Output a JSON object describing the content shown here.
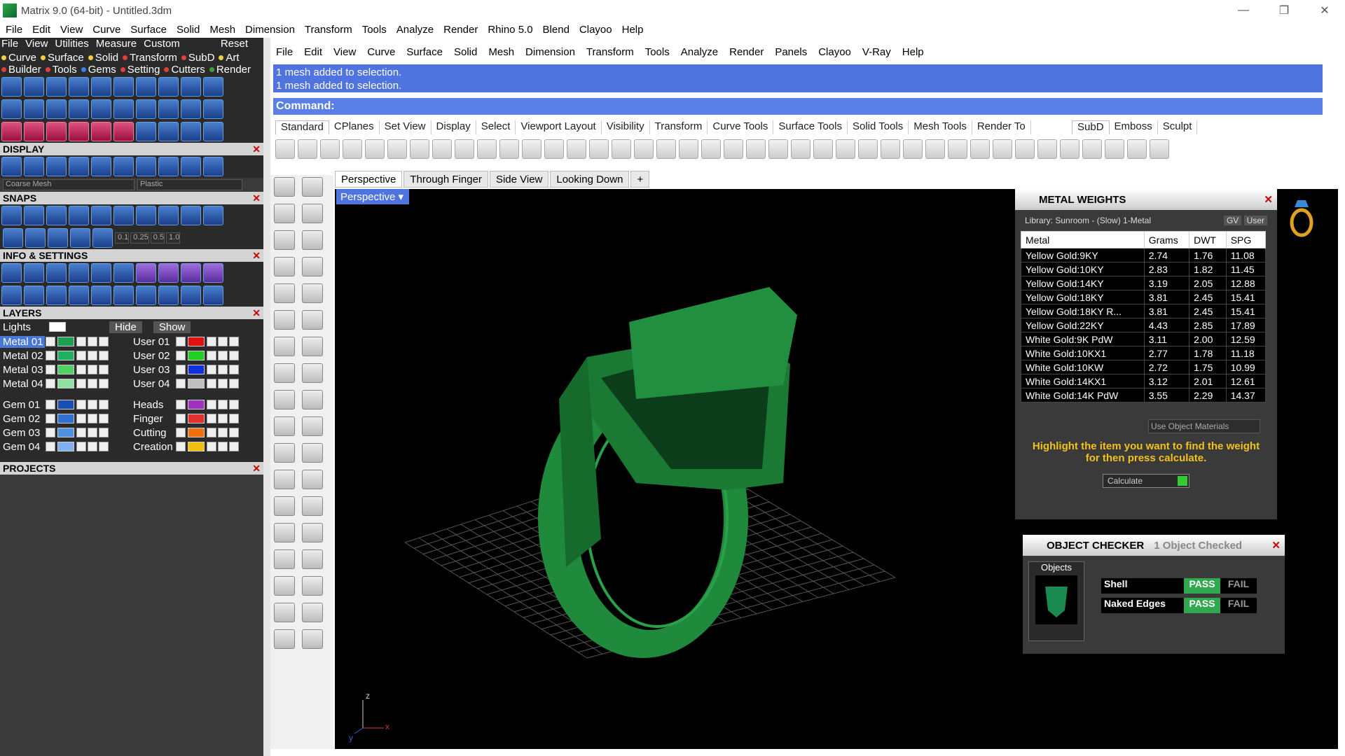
{
  "window": {
    "title": "Matrix 9.0 (64-bit) - Untitled.3dm"
  },
  "main_menu": [
    "File",
    "Edit",
    "View",
    "Curve",
    "Surface",
    "Solid",
    "Mesh",
    "Dimension",
    "Transform",
    "Tools",
    "Analyze",
    "Render",
    "Rhino 5.0",
    "Blend",
    "Clayoo",
    "Help"
  ],
  "left_menu": [
    "File",
    "View",
    "Utilities",
    "Measure",
    "Custom"
  ],
  "left_reset": "Reset",
  "tag_row1": [
    {
      "label": "Curve",
      "color": "#f0d040"
    },
    {
      "label": "Surface",
      "color": "#f0d040"
    },
    {
      "label": "Solid",
      "color": "#f0d040"
    },
    {
      "label": "Transform",
      "color": "#e04040"
    },
    {
      "label": "SubD",
      "color": "#e04040"
    },
    {
      "label": "Art",
      "color": "#f0d040"
    }
  ],
  "tag_row2": [
    {
      "label": "Builder",
      "color": "#e04040"
    },
    {
      "label": "Tools",
      "color": "#e04040"
    },
    {
      "label": "Gems",
      "color": "#4080e0"
    },
    {
      "label": "Setting",
      "color": "#e04040"
    },
    {
      "label": "Cutters",
      "color": "#e04040"
    },
    {
      "label": "Render",
      "color": "#40a040"
    }
  ],
  "sections": {
    "display": "DISPLAY",
    "snaps": "SNAPS",
    "info": "INFO & SETTINGS",
    "layers": "LAYERS",
    "projects": "PROJECTS"
  },
  "display_dd": {
    "mesh": "Coarse Mesh",
    "material": "Plastic"
  },
  "snap_values": [
    "0.1",
    "0.25",
    "0.5",
    "1.0"
  ],
  "layers_header": {
    "lights": "Lights",
    "hide": "Hide",
    "show": "Show"
  },
  "layers_left": [
    {
      "name": "Metal 01",
      "color": "#1fa050"
    },
    {
      "name": "Metal 02",
      "color": "#20b060"
    },
    {
      "name": "Metal 03",
      "color": "#50d060"
    },
    {
      "name": "Metal 04",
      "color": "#90e0a0"
    },
    {
      "name": "Gem 01",
      "color": "#1a4fb0"
    },
    {
      "name": "Gem 02",
      "color": "#3070d0"
    },
    {
      "name": "Gem 03",
      "color": "#5090e0"
    },
    {
      "name": "Gem 04",
      "color": "#80b0f0"
    }
  ],
  "layers_right": [
    {
      "name": "User 01",
      "color": "#e01010"
    },
    {
      "name": "User 02",
      "color": "#20d020"
    },
    {
      "name": "User 03",
      "color": "#1030e0"
    },
    {
      "name": "User 04",
      "color": "#c0c0c0"
    },
    {
      "name": "Heads",
      "color": "#a030c0"
    },
    {
      "name": "Finger",
      "color": "#e03030"
    },
    {
      "name": "Cutting",
      "color": "#f07010"
    },
    {
      "name": "Creation",
      "color": "#f0c010"
    }
  ],
  "right_menu": [
    "File",
    "Edit",
    "View",
    "Curve",
    "Surface",
    "Solid",
    "Mesh",
    "Dimension",
    "Transform",
    "Tools",
    "Analyze",
    "Render",
    "Panels",
    "Clayoo",
    "V-Ray",
    "Help"
  ],
  "command_history": [
    "1 mesh added to selection.",
    "1 mesh added to selection."
  ],
  "command_label": "Command:",
  "toolbar_tabs": [
    "Standard",
    "CPlanes",
    "Set View",
    "Display",
    "Select",
    "Viewport Layout",
    "Visibility",
    "Transform",
    "Curve Tools",
    "Surface Tools",
    "Solid Tools",
    "Mesh Tools",
    "Render To"
  ],
  "subd_tabs": [
    "SubD",
    "Emboss",
    "Sculpt"
  ],
  "viewport_tabs": [
    "Perspective",
    "Through Finger",
    "Side View",
    "Looking Down"
  ],
  "viewport_label": "Perspective",
  "metal_weights": {
    "title": "METAL WEIGHTS",
    "library": "Library: Sunroom - (Slow) 1-Metal",
    "gv": "GV",
    "user": "User",
    "columns": [
      "Metal",
      "Grams",
      "DWT",
      "SPG"
    ],
    "rows": [
      [
        "Yellow Gold:9KY",
        "2.74",
        "1.76",
        "11.08"
      ],
      [
        "Yellow Gold:10KY",
        "2.83",
        "1.82",
        "11.45"
      ],
      [
        "Yellow Gold:14KY",
        "3.19",
        "2.05",
        "12.88"
      ],
      [
        "Yellow Gold:18KY",
        "3.81",
        "2.45",
        "15.41"
      ],
      [
        "Yellow Gold:18KY R...",
        "3.81",
        "2.45",
        "15.41"
      ],
      [
        "Yellow Gold:22KY",
        "4.43",
        "2.85",
        "17.89"
      ],
      [
        "White Gold:9K PdW",
        "3.11",
        "2.00",
        "12.59"
      ],
      [
        "White Gold:10KX1",
        "2.77",
        "1.78",
        "11.18"
      ],
      [
        "White Gold:10KW",
        "2.72",
        "1.75",
        "10.99"
      ],
      [
        "White Gold:14KX1",
        "3.12",
        "2.01",
        "12.61"
      ],
      [
        "White Gold:14K PdW",
        "3.55",
        "2.29",
        "14.37"
      ]
    ],
    "materials_dd": "Use Object Materials",
    "hint": "Highlight the item you want to find the weight for then press calculate.",
    "calc": "Calculate"
  },
  "object_checker": {
    "title": "OBJECT CHECKER",
    "status": "1  Object Checked",
    "objects_label": "Objects",
    "checks": [
      {
        "name": "Shell",
        "pass": "PASS",
        "fail": "FAIL"
      },
      {
        "name": "Naked Edges",
        "pass": "PASS",
        "fail": "FAIL"
      }
    ]
  },
  "axis": {
    "x": "x",
    "y": "y",
    "z": "z"
  }
}
